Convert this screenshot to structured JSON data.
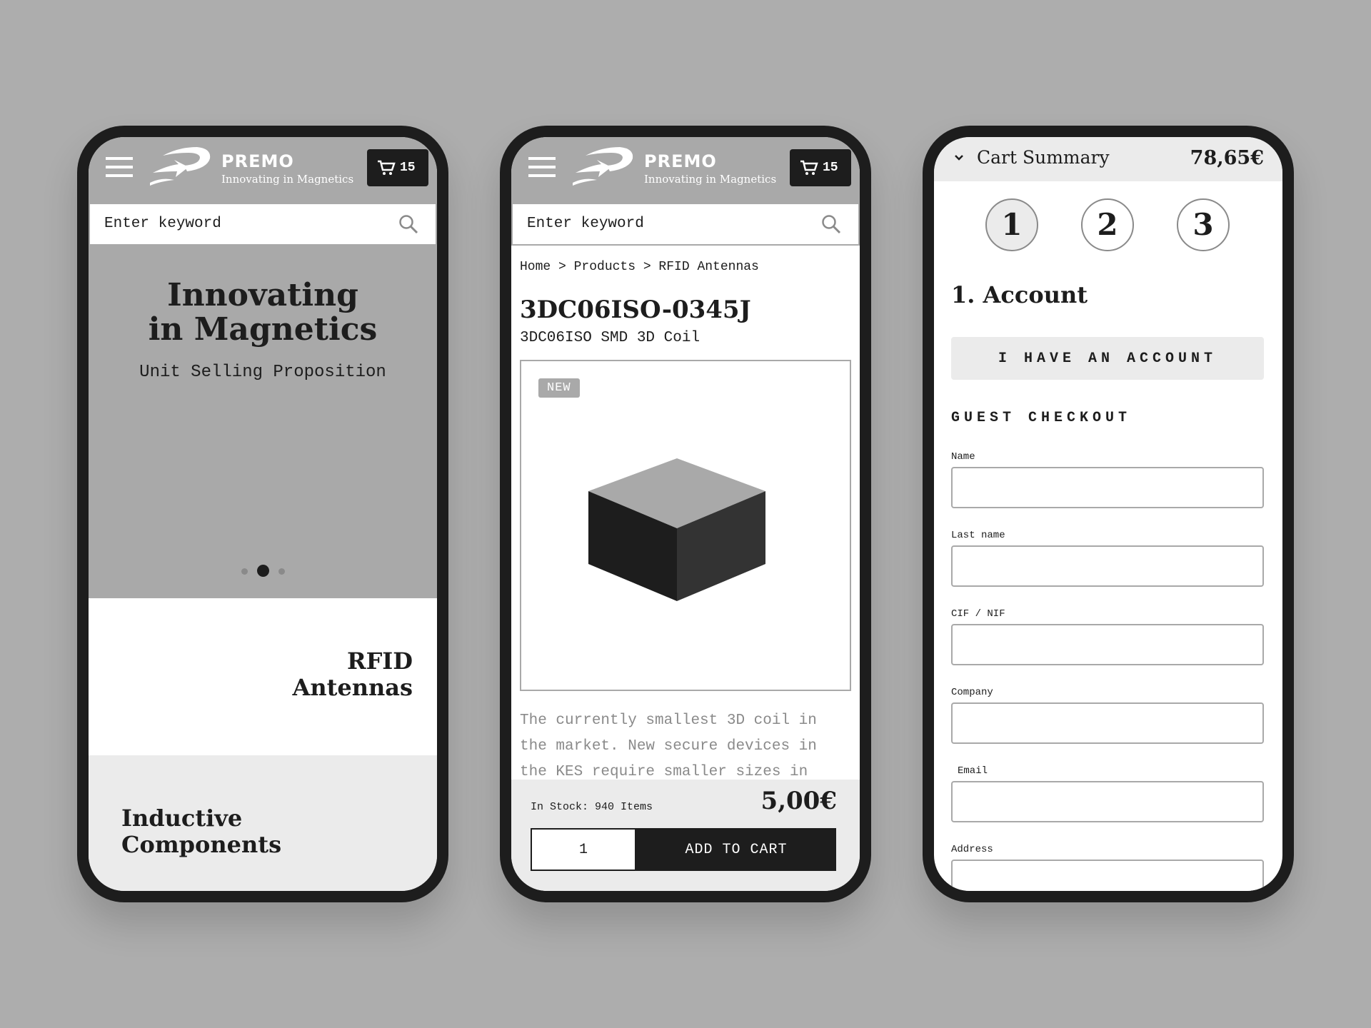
{
  "header": {
    "brand": "PREMO",
    "tagline": "Innovating in Magnetics",
    "cart_count": "15",
    "search_placeholder": "Enter keyword"
  },
  "home": {
    "hero_line1": "Innovating",
    "hero_line2": "in Magnetics",
    "hero_sub": "Unit Selling Proposition",
    "carousel_active_index": 1,
    "carousel_count": 3,
    "category1_line1": "RFID",
    "category1_line2": "Antennas",
    "category2_line1": "Inductive",
    "category2_line2": "Components"
  },
  "product": {
    "breadcrumb": "Home > Products > RFID Antennas",
    "title": "3DC06ISO-0345J",
    "subtitle": "3DC06ISO SMD 3D Coil",
    "badge": "NEW",
    "description": "The currently smallest 3D coil in the market. New secure devices in the KES require smaller sizes in",
    "stock": "In Stock: 940 Items",
    "price": "5,00€",
    "quantity": "1",
    "add_to_cart": "ADD TO CART"
  },
  "checkout": {
    "summary_label": "Cart Summary",
    "summary_total": "78,65€",
    "steps": [
      "1",
      "2",
      "3"
    ],
    "active_step": 1,
    "section_title": "1. Account",
    "have_account": "I HAVE AN ACCOUNT",
    "guest_title": "GUEST CHECKOUT",
    "fields": {
      "name": "Name",
      "last_name": "Last name",
      "cif": "CIF / NIF",
      "company": "Company",
      "email": "Email",
      "address": "Address"
    }
  },
  "colors": {
    "background": "#adadad",
    "frame": "#1d1d1d",
    "header": "#a9a9a9",
    "light": "#ebebeb"
  }
}
